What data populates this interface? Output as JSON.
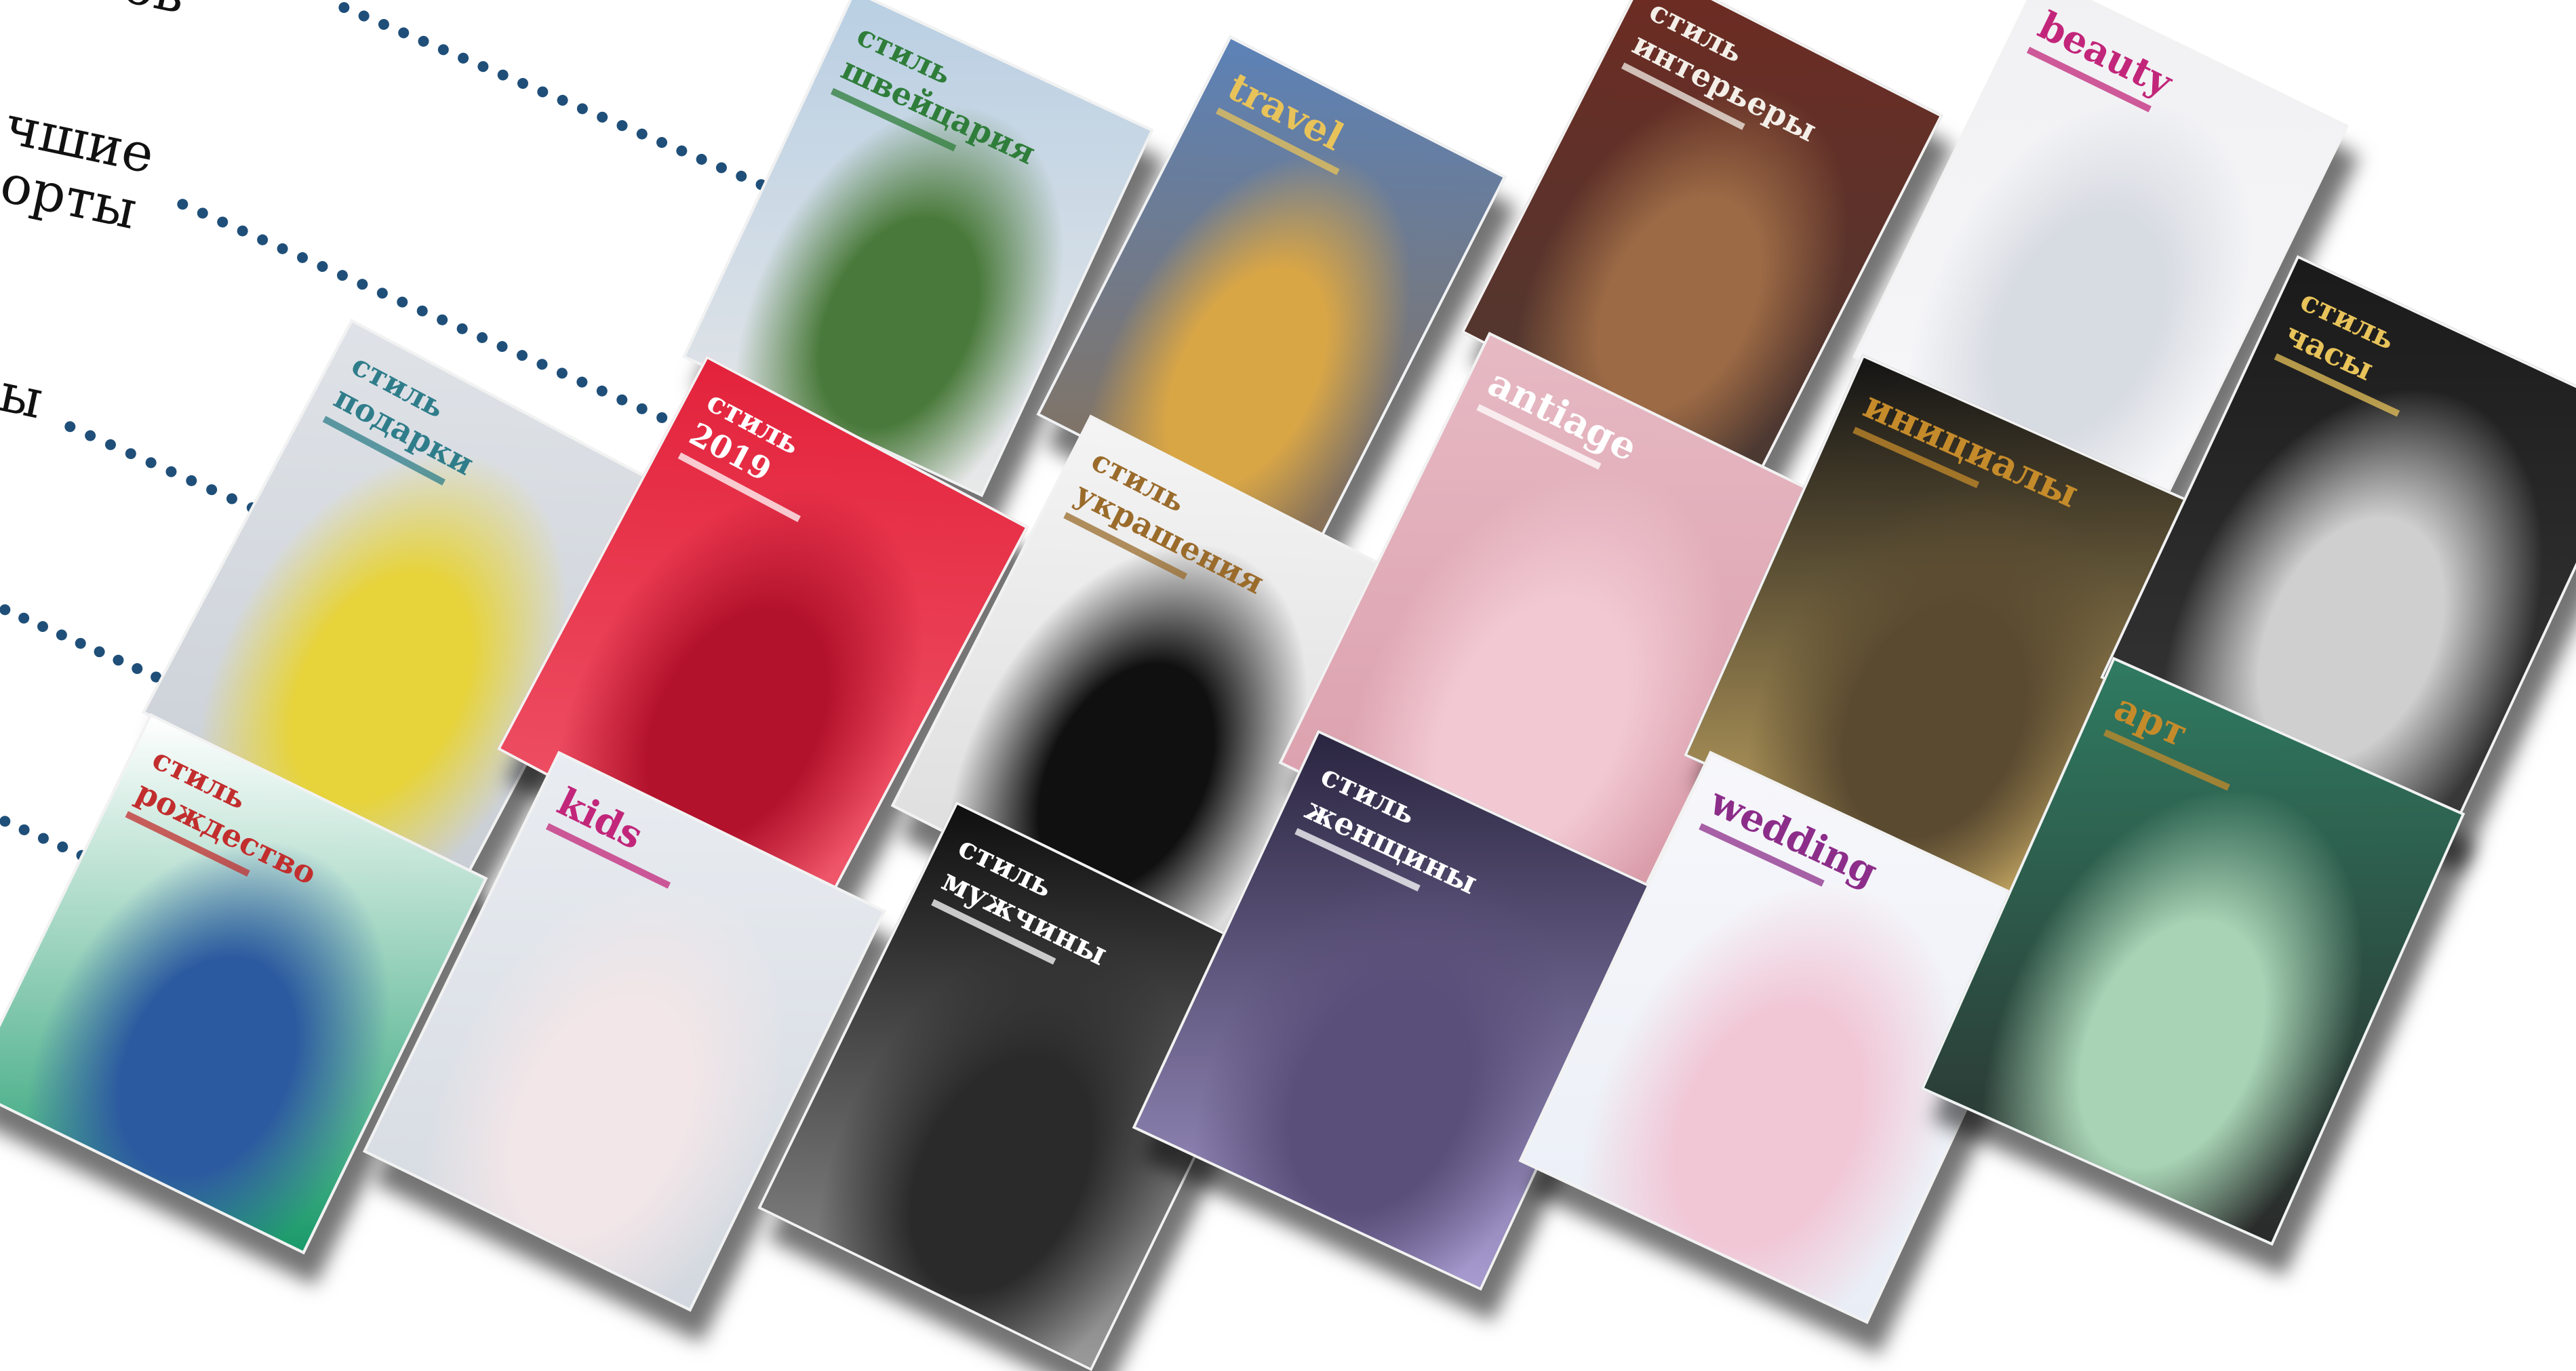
{
  "left_text": [
    {
      "text": "ов",
      "name": "left-text-1"
    },
    {
      "text": "чшие",
      "name": "left-text-2"
    },
    {
      "text": "орты",
      "name": "left-text-3"
    },
    {
      "text": "ы",
      "name": "left-text-4"
    }
  ],
  "magazines": [
    {
      "name": "magazine-cover-switzerland",
      "line1": "стиль",
      "line2": "швейцария",
      "palette": [
        "#b9cfe3",
        "#4a7a3b",
        "#e8e8e8"
      ],
      "text_color": "#2f7d3a"
    },
    {
      "name": "magazine-cover-travel",
      "line1": "travel",
      "line2": "",
      "palette": [
        "#5c82b8",
        "#d9a646",
        "#8a7052"
      ],
      "text_color": "#e8c35a"
    },
    {
      "name": "magazine-cover-interiors",
      "line1": "стиль",
      "line2": "интерьеры",
      "palette": [
        "#6e2b22",
        "#9c6a45",
        "#4a3a33"
      ],
      "text_color": "#f3efe8"
    },
    {
      "name": "magazine-cover-beauty",
      "line1": "beauty",
      "line2": "",
      "palette": [
        "#f1f1f4",
        "#d7dbe2",
        "#f7f7f9"
      ],
      "text_color": "#c2267a"
    },
    {
      "name": "magazine-cover-gifts",
      "line1": "стиль",
      "line2": "подарки",
      "palette": [
        "#dfe3e8",
        "#e7d33a",
        "#c9ced5"
      ],
      "text_color": "#2f7d8a"
    },
    {
      "name": "magazine-cover-2019",
      "line1": "стиль",
      "line2": "2019",
      "palette": [
        "#e3223b",
        "#b3122c",
        "#f05a6d"
      ],
      "text_color": "#ffffff"
    },
    {
      "name": "magazine-cover-jewelry",
      "line1": "стиль",
      "line2": "украшения",
      "palette": [
        "#f4f4f4",
        "#101010",
        "#d9d9d9"
      ],
      "text_color": "#9a6b2b"
    },
    {
      "name": "magazine-cover-antiage",
      "line1": "antiage",
      "line2": "",
      "palette": [
        "#e6b9c3",
        "#f2c9d3",
        "#d99aa8"
      ],
      "text_color": "#ffffff"
    },
    {
      "name": "magazine-cover-initials",
      "line1": "инициалы",
      "line2": "",
      "palette": [
        "#141414",
        "#5a4a30",
        "#d4b46a"
      ],
      "text_color": "#c58b2b"
    },
    {
      "name": "magazine-cover-watches",
      "line1": "стиль",
      "line2": "часы",
      "palette": [
        "#1a1a1a",
        "#cfcfcf",
        "#3a3a3a"
      ],
      "text_color": "#e8c35a"
    },
    {
      "name": "magazine-cover-christmas",
      "line1": "стиль",
      "line2": "рождество",
      "palette": [
        "#ffffff",
        "#2c5aa0",
        "#1a9a6a"
      ],
      "text_color": "#c22d2d"
    },
    {
      "name": "magazine-cover-kids",
      "line1": "kids",
      "line2": "",
      "palette": [
        "#e9edf2",
        "#f2e6e8",
        "#d3d8df"
      ],
      "text_color": "#c2267a"
    },
    {
      "name": "magazine-cover-men",
      "line1": "стиль",
      "line2": "мужчины",
      "palette": [
        "#0f0f0f",
        "#2a2a2a",
        "#9a9a9a"
      ],
      "text_color": "#ffffff"
    },
    {
      "name": "magazine-cover-women",
      "line1": "стиль",
      "line2": "женщины",
      "palette": [
        "#2a2540",
        "#5a4f7a",
        "#a79bd0"
      ],
      "text_color": "#ffffff"
    },
    {
      "name": "magazine-cover-wedding",
      "line1": "wedding",
      "line2": "",
      "palette": [
        "#f7f7fb",
        "#f1c6d5",
        "#e9eef6"
      ],
      "text_color": "#8c2d8a"
    },
    {
      "name": "magazine-cover-art",
      "line1": "арт",
      "line2": "",
      "palette": [
        "#2f7b61",
        "#a8d3b4",
        "#2a2a2a"
      ],
      "text_color": "#c58b2b"
    }
  ]
}
